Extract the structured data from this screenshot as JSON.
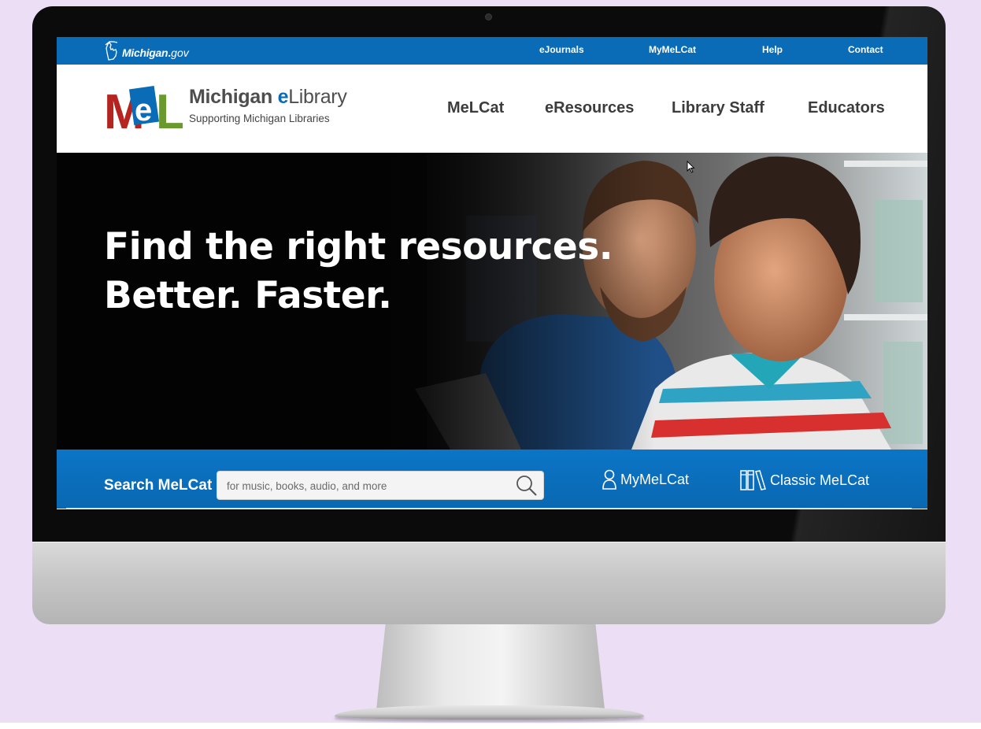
{
  "colors": {
    "page_background": "#ecdff5",
    "brand_blue": "#0a6bb7",
    "logo_red": "#b5241f",
    "logo_blue": "#0a6bb7",
    "logo_green": "#6a9a2e",
    "nav_text": "#3c3c3c"
  },
  "utility_bar": {
    "gov_logo": {
      "name": "Michigan",
      "dot": ".",
      "tld": "gov",
      "icon": "michigan-mitten-icon"
    },
    "links": [
      "eJournals",
      "MyMeLCat",
      "Help",
      "Contact"
    ]
  },
  "header": {
    "logo": {
      "letters": [
        "M",
        "e",
        "L"
      ]
    },
    "brand_title_bold": "Michigan",
    "brand_title_e": "e",
    "brand_title_rest": "Library",
    "brand_subtitle": "Supporting Michigan Libraries",
    "nav": [
      "MeLCat",
      "eResources",
      "Library Staff",
      "Educators"
    ]
  },
  "hero": {
    "line1": "Find the right resources.",
    "line2": "Better. Faster."
  },
  "search": {
    "label": "Search MeLCat",
    "placeholder": "for music, books, audio, and more",
    "value": "",
    "button_icon": "search-icon",
    "quick_links": [
      {
        "label": "MyMeLCat",
        "icon": "user-icon"
      },
      {
        "label": "Classic MeLCat",
        "icon": "books-icon"
      }
    ]
  }
}
